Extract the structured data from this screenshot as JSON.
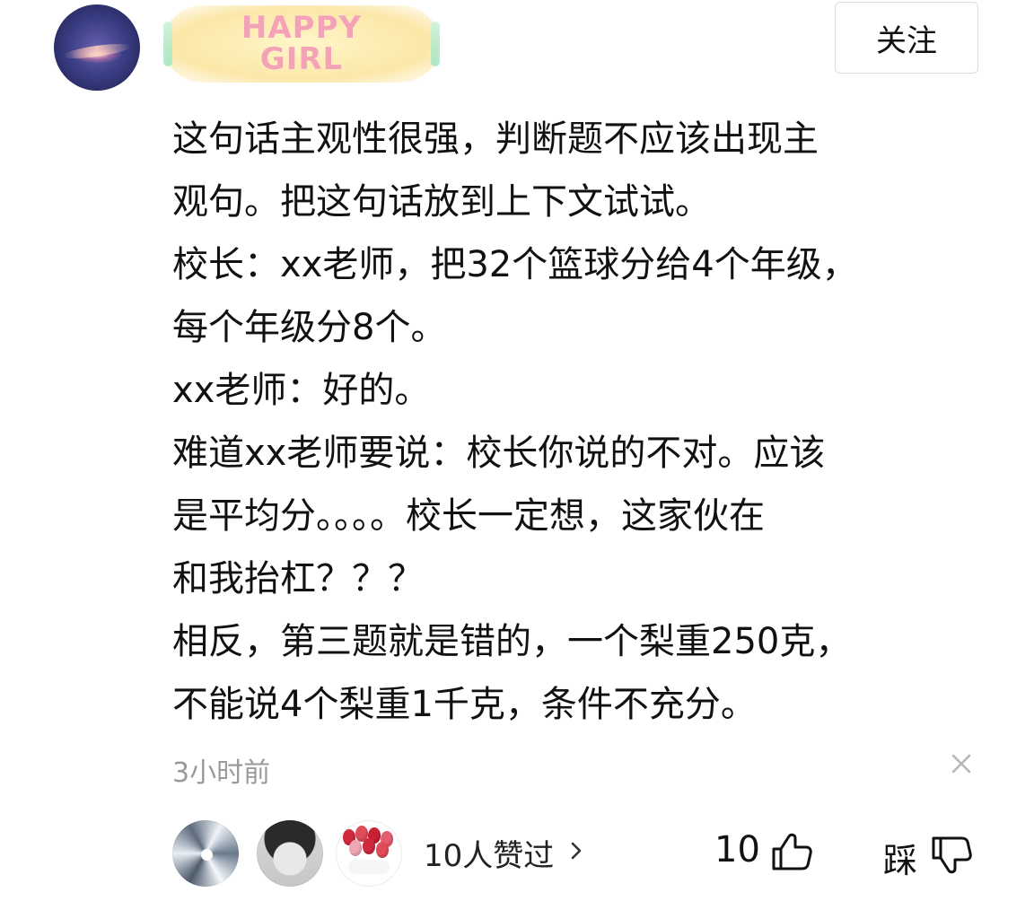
{
  "header": {
    "username_badge": "HAPPY\nGIRL",
    "follow_label": "关注"
  },
  "comment": {
    "lines": [
      "这句话主观性很强，判断题不应该出现主",
      "观句。把这句话放到上下文试试。",
      "校长：xx老师，把32个篮球分给4个年级，",
      "每个年级分8个。",
      "xx老师：好的。",
      "难道xx老师要说：校长你说的不对。应该",
      "是平均分。。。。校长一定想，这家伙在",
      "和我抬杠？？？",
      "相反，第三题就是错的，一个梨重250克，",
      "不能说4个梨重1千克，条件不充分。"
    ],
    "time_ago": "3小时前"
  },
  "footer": {
    "likers_avatars": [
      "avatar-1",
      "avatar-2",
      "avatar-3"
    ],
    "likers_summary": "10人赞过",
    "like_count": "10",
    "dislike_label": "踩"
  },
  "icons": {
    "close": "close-icon",
    "chevron": "chevron-right-icon",
    "thumb_up": "thumb-up-icon",
    "thumb_down": "thumb-down-icon"
  },
  "colors": {
    "text": "#111111",
    "muted": "#9a9a9a",
    "badge_pink": "#f4a3b7",
    "badge_yellow": "#fbe7a8"
  }
}
